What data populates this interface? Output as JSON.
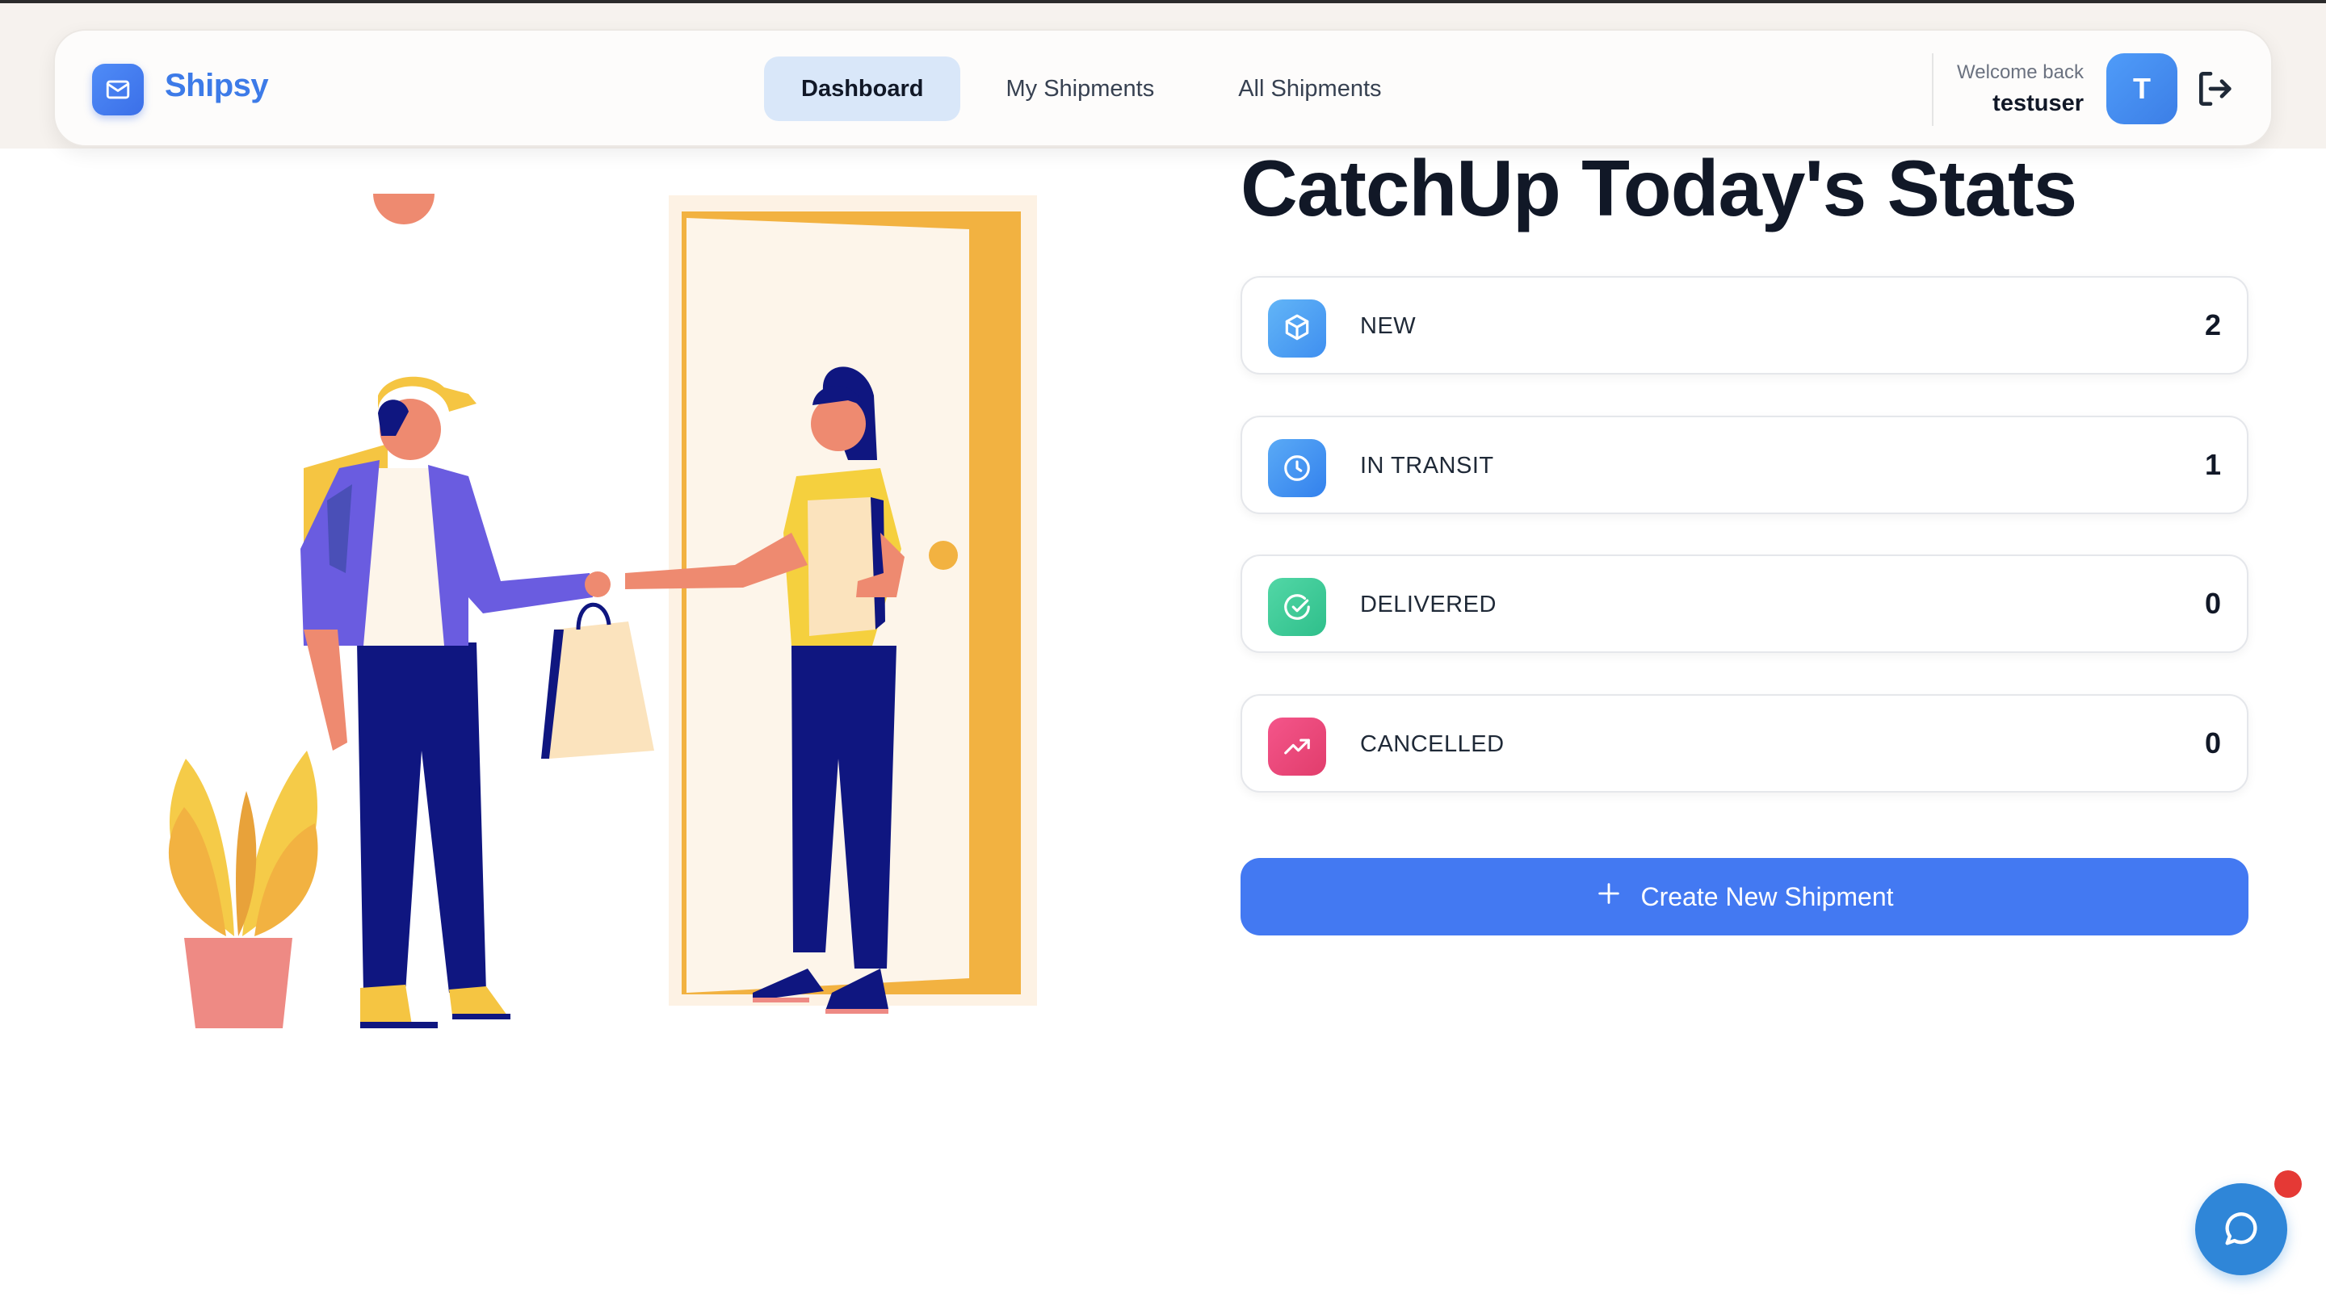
{
  "brand": {
    "name": "Shipsy",
    "logo_icon": "mail-icon",
    "color": "#3d7be8"
  },
  "nav": {
    "tabs": [
      {
        "label": "Dashboard",
        "active": true
      },
      {
        "label": "My Shipments",
        "active": false
      },
      {
        "label": "All Shipments",
        "active": false
      }
    ]
  },
  "user": {
    "welcome_label": "Welcome back",
    "username": "testuser",
    "avatar_initial": "T",
    "logout_icon": "logout-icon"
  },
  "illustration": {
    "description_icon": "delivery-illustration"
  },
  "stats": {
    "title": "CatchUp Today's Stats",
    "items": [
      {
        "label": "NEW",
        "value": "2",
        "icon": "package-icon",
        "color": "#4fa3f5"
      },
      {
        "label": "IN TRANSIT",
        "value": "1",
        "icon": "clock-icon",
        "color": "#3d8ff0"
      },
      {
        "label": "DELIVERED",
        "value": "0",
        "icon": "check-circle-icon",
        "color": "#3ecf9a"
      },
      {
        "label": "CANCELLED",
        "value": "0",
        "icon": "trending-up-icon",
        "color": "#ef4a7a"
      }
    ]
  },
  "actions": {
    "create_label": "Create New Shipment",
    "create_icon": "plus-icon",
    "button_color": "#4379f2"
  },
  "chat": {
    "icon": "chat-icon",
    "color": "#2f86d8",
    "badge_color": "#e53935"
  }
}
